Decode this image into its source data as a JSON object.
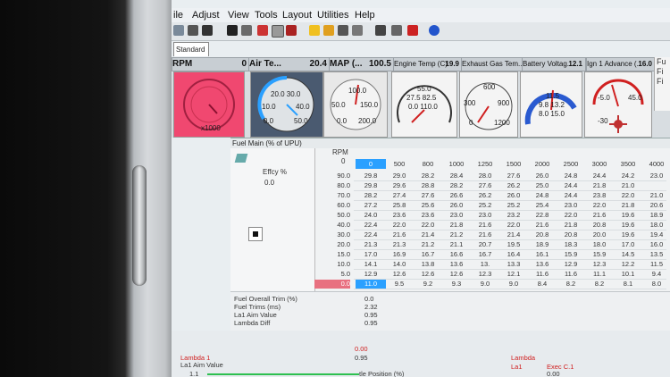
{
  "menu": [
    "ile",
    "Adjust",
    "View",
    "Tools",
    "Layout",
    "Utilities",
    "Help"
  ],
  "tab": "Standard",
  "gauges": [
    {
      "label": "RPM",
      "value": "0",
      "ticks": [
        "x1000"
      ],
      "face": "#f04870"
    },
    {
      "label": "Air Te...",
      "value": "20.4",
      "ticks": [
        "20.0 30.0",
        "10.0",
        "40.0",
        "0.0",
        "50.0"
      ],
      "face": "#4a5a70"
    },
    {
      "label": "MAP (...",
      "value": "100.5",
      "ticks": [
        "100.0",
        "50.0",
        "150.0",
        "0.0",
        "200.0"
      ],
      "face": "#e8e8e8"
    },
    {
      "label": "Engine Temp (C)",
      "value": "19.9",
      "ticks": [
        "55.0",
        "27.5 82.5",
        "0.0 110.0"
      ],
      "face": "#f4f4f4"
    },
    {
      "label": "Exhaust Gas Tem...",
      "value": "",
      "ticks": [
        "600",
        "300",
        "900",
        "0",
        "1200"
      ],
      "face": "#f4f4f4"
    },
    {
      "label": "Battery Voltag...",
      "value": "12.1",
      "ticks": [
        "11.5",
        "9.8 13.2",
        "8.0 15.0"
      ],
      "face": "#f4f4f4"
    },
    {
      "label": "Ign 1 Advance (...",
      "value": "16.0",
      "ticks": [
        "-5.0",
        "45.0",
        "-30"
      ],
      "face": "#f4f4f4"
    }
  ],
  "right_panel": [
    "Fu",
    "Fi",
    "Fi"
  ],
  "fuel_table": {
    "title": "Fuel Main (% of UPU)",
    "rpm_label": "RPM",
    "rpm_current": "0",
    "efficiency_label": "Effcy %",
    "efficiency_value": "0.0",
    "rpm_axis": [
      "0",
      "500",
      "800",
      "1000",
      "1250",
      "1500",
      "2000",
      "2500",
      "3000",
      "3500",
      "4000"
    ],
    "load_axis": [
      "90.0",
      "80.0",
      "70.0",
      "60.0",
      "50.0",
      "40.0",
      "30.0",
      "20.0",
      "15.0",
      "10.0",
      "5.0",
      "0.0"
    ],
    "rows": [
      [
        "29.8",
        "29.0",
        "28.2",
        "28.4",
        "28.0",
        "27.6",
        "26.0",
        "24.8",
        "24.4",
        "24.2",
        "23.0"
      ],
      [
        "29.8",
        "29.6",
        "28.8",
        "28.2",
        "27.6",
        "26.2",
        "25.0",
        "24.4",
        "21.8",
        "21.0",
        ""
      ],
      [
        "28.2",
        "27.4",
        "27.6",
        "26.6",
        "26.2",
        "26.0",
        "24.8",
        "24.4",
        "23.8",
        "22.0",
        "21.0"
      ],
      [
        "27.2",
        "25.8",
        "25.6",
        "26.0",
        "25.2",
        "25.2",
        "25.4",
        "23.0",
        "22.0",
        "21.8",
        "20.6"
      ],
      [
        "24.0",
        "23.6",
        "23.6",
        "23.0",
        "23.0",
        "23.2",
        "22.8",
        "22.0",
        "21.6",
        "19.6",
        "18.9"
      ],
      [
        "22.4",
        "22.0",
        "22.0",
        "21.8",
        "21.6",
        "22.0",
        "21.6",
        "21.8",
        "20.8",
        "19.6",
        "18.0"
      ],
      [
        "22.4",
        "21.6",
        "21.4",
        "21.2",
        "21.6",
        "21.4",
        "20.8",
        "20.8",
        "20.0",
        "19.6",
        "19.4"
      ],
      [
        "21.3",
        "21.3",
        "21.2",
        "21.1",
        "20.7",
        "19.5",
        "18.9",
        "18.3",
        "18.0",
        "17.0",
        "16.0"
      ],
      [
        "17.0",
        "16.9",
        "16.7",
        "16.6",
        "16.7",
        "16.4",
        "16.1",
        "15.9",
        "15.9",
        "14.5",
        "13.5"
      ],
      [
        "14.1",
        "14.0",
        "13.8",
        "13.6",
        "13.",
        "13.3",
        "13.6",
        "12.9",
        "12.3",
        "12.2",
        "11.5"
      ],
      [
        "12.9",
        "12.6",
        "12.6",
        "12.6",
        "12.3",
        "12.1",
        "11.6",
        "11.6",
        "11.1",
        "10.1",
        "9.4"
      ],
      [
        "11.0",
        "9.5",
        "9.2",
        "9.3",
        "9.0",
        "9.0",
        "8.4",
        "8.2",
        "8.2",
        "8.1",
        "8.0"
      ]
    ]
  },
  "stats": [
    {
      "label": "Fuel Overall Trim (%)",
      "value": "0.0"
    },
    {
      "label": "Fuel Trims (ms)",
      "value": "2.32"
    },
    {
      "label": "La1 Aim Value",
      "value": "0.95"
    },
    {
      "label": "Lambda Diff",
      "value": "0.95"
    }
  ],
  "bottom": {
    "lambda_label": "Lambda 1",
    "lambda_value": "0.00",
    "la1_aim_label": "La1 Aim Value",
    "la1_aim_value": "0.95",
    "la1_small": "1.1",
    "throttle_label": "tle Position (%)",
    "lambda_right": "Lambda",
    "la1_right": "La1",
    "exec_label": "Exec C.1",
    "exec_value": "0.00"
  },
  "colors": {
    "accent_blue": "#2aa0ff",
    "rpm_red": "#f04870",
    "row_selected": "#e87080"
  }
}
